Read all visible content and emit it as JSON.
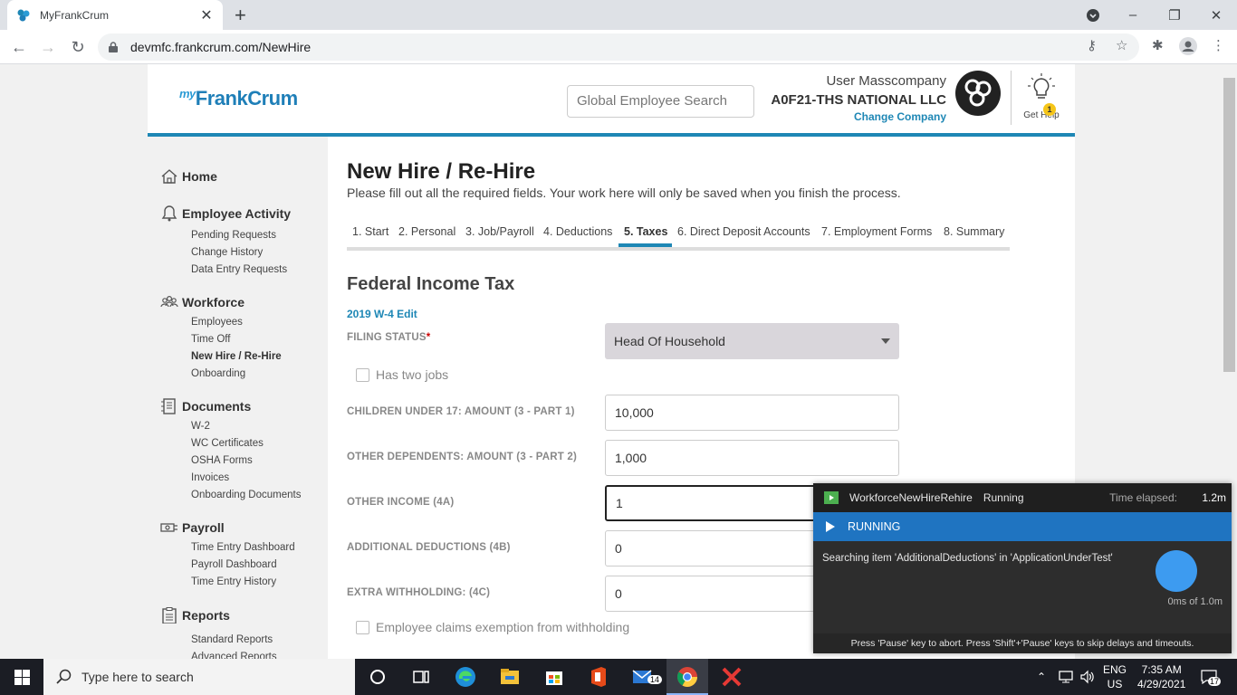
{
  "browser": {
    "tab_title": "MyFrankCrum",
    "url": "devmfc.frankcrum.com/NewHire"
  },
  "header": {
    "logo_my": "my",
    "logo_text": "FrankCrum",
    "search_placeholder": "Global Employee Search",
    "user_name": "User Masscompany",
    "company": "A0F21-THS NATIONAL LLC",
    "change_company": "Change Company",
    "get_help": "Get Help",
    "help_badge": "1"
  },
  "sidebar": {
    "home": "Home",
    "employee_activity": {
      "title": "Employee Activity",
      "items": [
        "Pending Requests",
        "Change History",
        "Data Entry Requests"
      ]
    },
    "workforce": {
      "title": "Workforce",
      "items": [
        "Employees",
        "Time Off",
        "New Hire / Re-Hire",
        "Onboarding"
      ]
    },
    "documents": {
      "title": "Documents",
      "items": [
        "W-2",
        "WC Certificates",
        "OSHA Forms",
        "Invoices",
        "Onboarding Documents"
      ]
    },
    "payroll": {
      "title": "Payroll",
      "items": [
        "Time Entry Dashboard",
        "Payroll Dashboard",
        "Time Entry History"
      ]
    },
    "reports": {
      "title": "Reports",
      "items": [
        "Standard Reports",
        "Advanced Reports"
      ]
    }
  },
  "main": {
    "title": "New Hire / Re-Hire",
    "subtitle": "Please fill out all the required fields. Your work here will only be saved when you finish the process.",
    "steps": [
      "1. Start",
      "2. Personal",
      "3. Job/Payroll",
      "4. Deductions",
      "5. Taxes",
      "6. Direct Deposit Accounts",
      "7. Employment Forms",
      "8. Summary"
    ],
    "active_step": "5. Taxes",
    "section_title": "Federal Income Tax",
    "w4_link": "2019 W-4 Edit",
    "filing_status_label": "FILING STATUS",
    "filing_status_required": "*",
    "filing_status_value": "Head Of Household",
    "two_jobs_label": "Has two jobs",
    "children_label": "CHILDREN UNDER 17: AMOUNT (3 - PART 1)",
    "children_value": "10,000",
    "other_dependents_label": "OTHER DEPENDENTS: AMOUNT (3 - PART 2)",
    "other_dependents_value": "1,000",
    "other_income_label": "OTHER INCOME (4A)",
    "other_income_value": "1",
    "additional_deductions_label": "ADDITIONAL DEDUCTIONS (4B)",
    "additional_deductions_value": "0",
    "extra_withholding_label": "EXTRA WITHHOLDING: (4C)",
    "extra_withholding_value": "0",
    "exemption_label": "Employee claims exemption from withholding"
  },
  "runner": {
    "test_name": "WorkforceNewHireRehire",
    "state": "Running",
    "time_elapsed_label": "Time elapsed:",
    "time_elapsed": "1.2m",
    "banner": "RUNNING",
    "message": "Searching item 'AdditionalDeductions' in 'ApplicationUnderTest'",
    "timer": "0ms of 1.0m",
    "footer": "Press 'Pause' key to abort. Press 'Shift'+'Pause' keys to skip delays and timeouts."
  },
  "taskbar": {
    "search_placeholder": "Type here to search",
    "mail_badge": "14",
    "lang_top": "ENG",
    "lang_bottom": "US",
    "time": "7:35 AM",
    "date": "4/29/2021",
    "notif_count": "17"
  },
  "colors": {
    "brand_blue": "#1e87b5",
    "runner_blue": "#1f74c1"
  }
}
